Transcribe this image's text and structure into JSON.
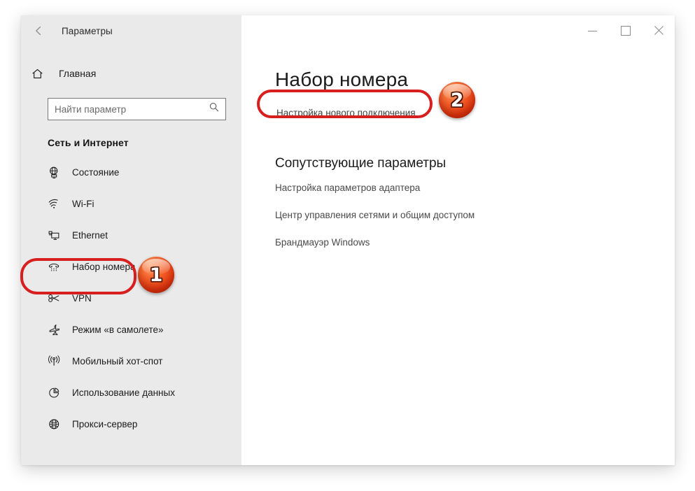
{
  "window": {
    "titlebar": {
      "back_icon": "back-arrow-icon",
      "app_title": "Параметры",
      "minimize_label": "—",
      "maximize_label": "□",
      "close_label": "✕"
    }
  },
  "sidebar": {
    "home": {
      "icon": "home-icon",
      "label": "Главная"
    },
    "search": {
      "icon": "search-icon",
      "placeholder": "Найти параметр",
      "value": ""
    },
    "section_title": "Сеть и Интернет",
    "items": [
      {
        "icon": "status-globe-icon",
        "label": "Состояние",
        "selected": false
      },
      {
        "icon": "wifi-icon",
        "label": "Wi-Fi",
        "selected": false
      },
      {
        "icon": "ethernet-icon",
        "label": "Ethernet",
        "selected": false
      },
      {
        "icon": "dialup-phone-icon",
        "label": "Набор номера",
        "selected": true
      },
      {
        "icon": "vpn-icon",
        "label": "VPN",
        "selected": false
      },
      {
        "icon": "airplane-icon",
        "label": "Режим «в самолете»",
        "selected": false
      },
      {
        "icon": "hotspot-icon",
        "label": "Мобильный хот-спот",
        "selected": false
      },
      {
        "icon": "data-usage-pie-icon",
        "label": "Использование данных",
        "selected": false
      },
      {
        "icon": "proxy-globe-icon",
        "label": "Прокси-сервер",
        "selected": false
      }
    ]
  },
  "main": {
    "page_title": "Набор номера",
    "setup_link": "Настройка нового подключения",
    "related_title": "Сопутствующие параметры",
    "related_links": [
      "Настройка параметров адаптера",
      "Центр управления сетями и общим доступом",
      "Брандмауэр Windows"
    ]
  },
  "annotations": {
    "badges": [
      {
        "number": "1",
        "target": "sidebar-item-dialup"
      },
      {
        "number": "2",
        "target": "setup-new-connection-link"
      }
    ],
    "highlight_color": "#d81f1f"
  }
}
